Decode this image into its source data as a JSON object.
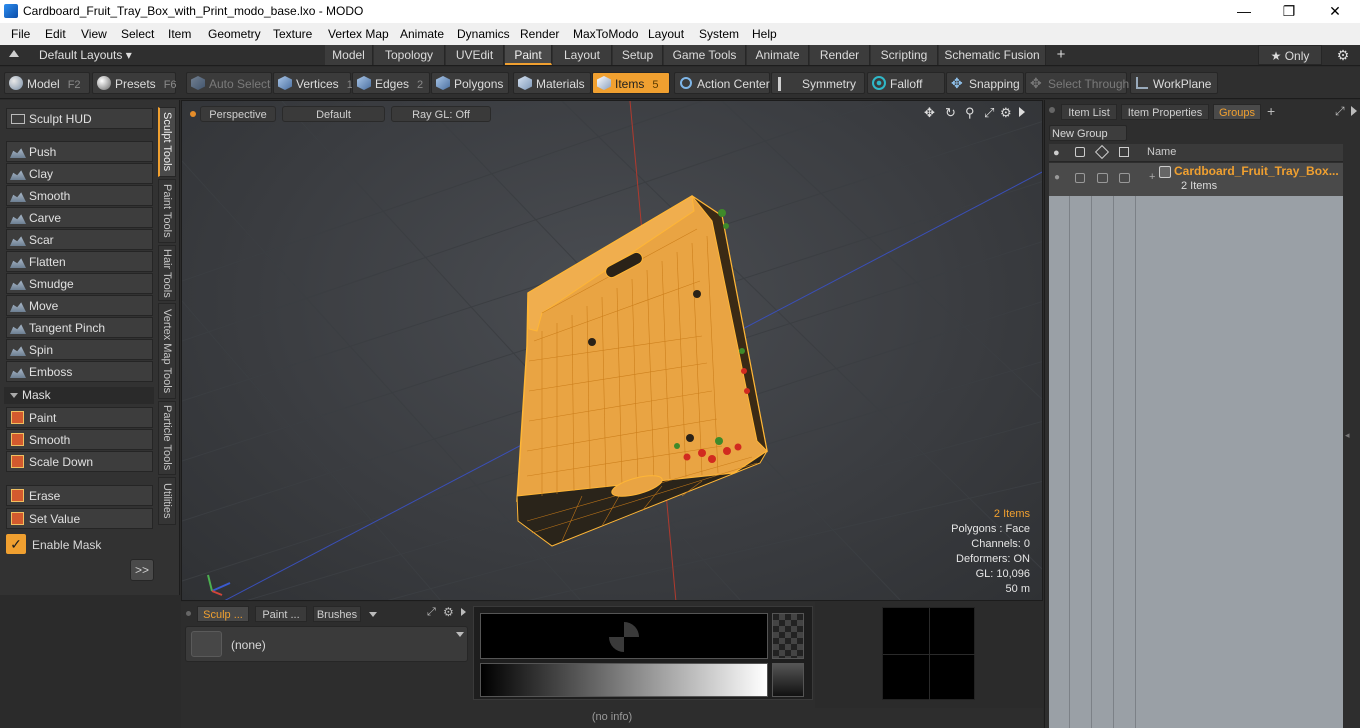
{
  "window": {
    "title": "Cardboard_Fruit_Tray_Box_with_Print_modo_base.lxo - MODO",
    "minimize": "—",
    "maximize": "❐",
    "close": "✕"
  },
  "menu": [
    "File",
    "Edit",
    "View",
    "Select",
    "Item",
    "Geometry",
    "Texture",
    "Vertex Map",
    "Animate",
    "Dynamics",
    "Render",
    "MaxToModo",
    "Layout",
    "System",
    "Help"
  ],
  "layoutbar": {
    "layouts_label": "Default Layouts ▾",
    "tabs": [
      "Model",
      "Topology",
      "UVEdit",
      "Paint",
      "Layout",
      "Setup",
      "Game Tools",
      "Animate",
      "Render",
      "Scripting",
      "Schematic Fusion"
    ],
    "active_tab": "Paint",
    "add": "+",
    "only_label": "★  Only",
    "gear": "⚙"
  },
  "toolbar": {
    "model": "Model",
    "model_key": "F2",
    "presets": "Presets",
    "presets_key": "F6",
    "auto_select": "Auto Select",
    "vertices": "Vertices",
    "vertices_key": "1",
    "edges": "Edges",
    "edges_key": "2",
    "polygons": "Polygons",
    "materials": "Materials",
    "items": "Items",
    "items_key": "5",
    "action_center": "Action Center",
    "symmetry": "Symmetry",
    "falloff": "Falloff",
    "snapping": "Snapping",
    "select_through": "Select Through",
    "workplane": "WorkPlane"
  },
  "sculpt": {
    "hud": "Sculpt HUD",
    "tools": [
      "Push",
      "Clay",
      "Smooth",
      "Carve",
      "Scar",
      "Flatten",
      "Smudge",
      "Move",
      "Tangent Pinch",
      "Spin",
      "Emboss"
    ],
    "mask_header": "Mask",
    "mask_tools": [
      "Paint",
      "Smooth",
      "Scale Down"
    ],
    "erase": "Erase",
    "set_value": "Set Value",
    "enable_mask": "Enable Mask",
    "expand": ">>"
  },
  "vtabs": [
    "Sculpt Tools",
    "Paint Tools",
    "Hair Tools",
    "Vertex Map Tools",
    "Particle Tools",
    "Utilities"
  ],
  "viewport": {
    "view": "Perspective",
    "shading": "Default",
    "raygl": "Ray GL: Off",
    "hud": {
      "items": "2 Items",
      "polygons": "Polygons : Face",
      "channels": "Channels: 0",
      "deformers": "Deformers: ON",
      "gl": "GL: 10,096",
      "scale": "50 m"
    }
  },
  "rightpanel": {
    "tabs": [
      "Item List",
      "Item Properties",
      "Groups"
    ],
    "active_tab": "Groups",
    "add": "+",
    "new_group": "New Group",
    "name_header": "Name",
    "group_name": "Cardboard_Fruit_Tray_Box...",
    "group_count": "2 Items"
  },
  "bottom": {
    "tabs": [
      "Sculp ...",
      "Paint ...",
      "Brushes"
    ],
    "active_tab": "Sculp ...",
    "preset_value": "(none)"
  },
  "status": "(no info)",
  "colors": {
    "accent": "#f0a030",
    "selection": "#f5a623"
  }
}
